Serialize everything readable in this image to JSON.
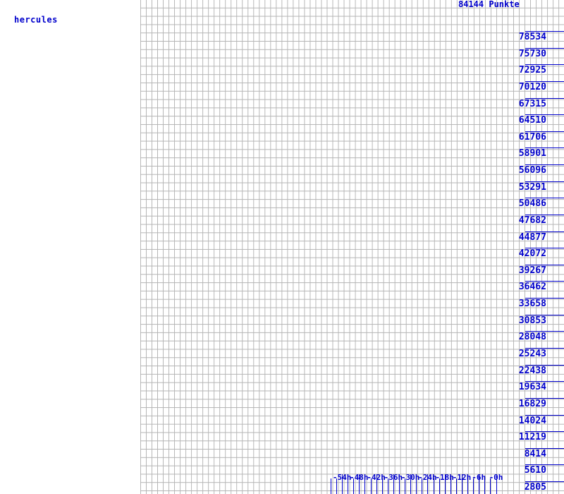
{
  "legend": {
    "label": "hercules",
    "color": "#0000cc"
  },
  "title": "84144 Punkte",
  "colors": {
    "axis": "#0000cc",
    "grid": "#b4b4b4",
    "background": "#ffffff"
  },
  "chart_data": {
    "type": "line",
    "title": "84144 Punkte",
    "xlabel": "",
    "ylabel": "",
    "grid": true,
    "legend_position": "top-left",
    "series": [
      {
        "name": "hercules",
        "color": "#0000cc",
        "x": [],
        "values": []
      }
    ],
    "xlim": [
      -60,
      0
    ],
    "xunit": "h",
    "ylim": [
      0,
      84144
    ],
    "x_tick_labels": [
      "-54h",
      "-48h",
      "-42h",
      "-36h",
      "-30h",
      "-24h",
      "-18h",
      "-12h",
      "-6h",
      "-0h"
    ],
    "x_tick_values": [
      -54,
      -48,
      -42,
      -36,
      -30,
      -24,
      -18,
      -12,
      -6,
      0
    ],
    "x_minor_tick_interval": 2,
    "y_tick_labels": [
      "78534",
      "75730",
      "72925",
      "70120",
      "67315",
      "64510",
      "61706",
      "58901",
      "56096",
      "53291",
      "50486",
      "47682",
      "44877",
      "42072",
      "39267",
      "36462",
      "33658",
      "30853",
      "28048",
      "25243",
      "22438",
      "19634",
      "16829",
      "14024",
      "11219",
      "8414",
      "5610",
      "2805"
    ],
    "y_tick_values": [
      78534,
      75730,
      72925,
      70120,
      67315,
      64510,
      61706,
      58901,
      56096,
      53291,
      50486,
      47682,
      44877,
      42072,
      39267,
      36462,
      33658,
      30853,
      28048,
      25243,
      22438,
      19634,
      16829,
      14024,
      11219,
      8414,
      5610,
      2805
    ],
    "y_tick_step": 2805,
    "note": "plot area contains no plotted data points in the visible frame"
  }
}
